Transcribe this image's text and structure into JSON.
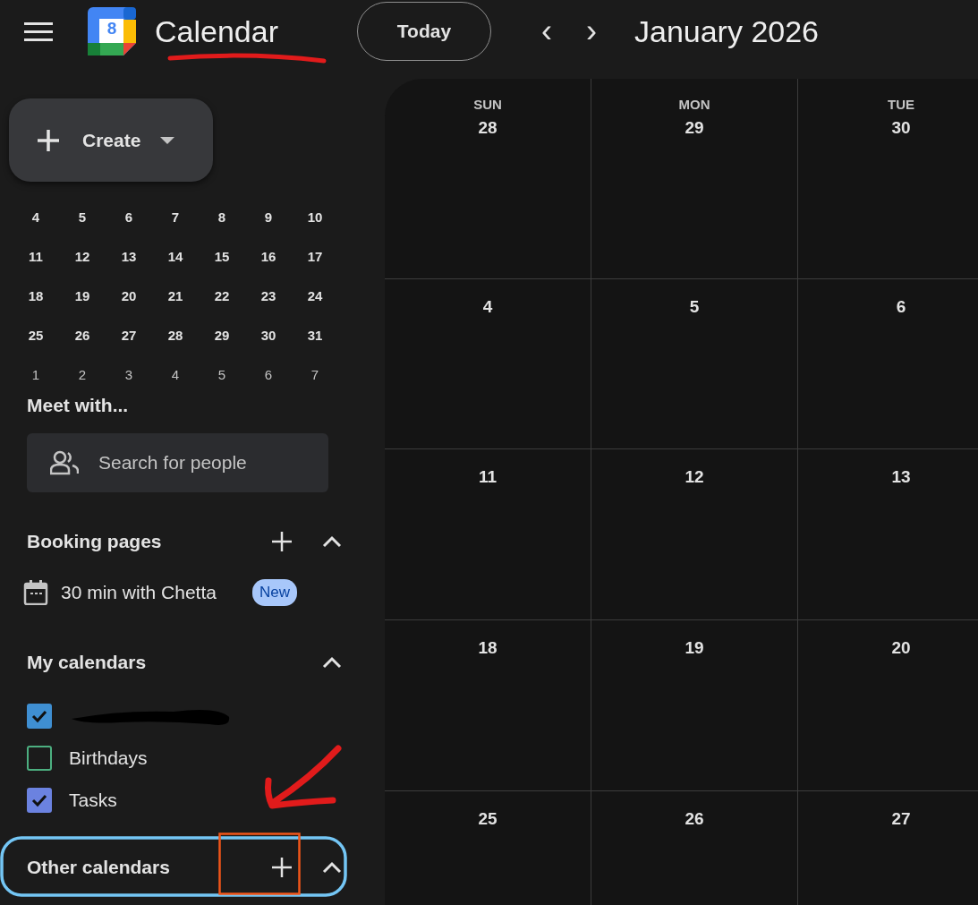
{
  "header": {
    "logo_digit": "8",
    "app_title": "Calendar",
    "today_button": "Today",
    "prev": "‹",
    "next": "›",
    "month_title": "January 2026"
  },
  "sidebar": {
    "create_button": "Create",
    "mini_calendar": {
      "weeks": [
        {
          "other_month": false,
          "days": [
            "4",
            "5",
            "6",
            "7",
            "8",
            "9",
            "10"
          ]
        },
        {
          "other_month": false,
          "days": [
            "11",
            "12",
            "13",
            "14",
            "15",
            "16",
            "17"
          ]
        },
        {
          "other_month": false,
          "days": [
            "18",
            "19",
            "20",
            "21",
            "22",
            "23",
            "24"
          ]
        },
        {
          "other_month": false,
          "days": [
            "25",
            "26",
            "27",
            "28",
            "29",
            "30",
            "31"
          ]
        },
        {
          "other_month": true,
          "days": [
            "1",
            "2",
            "3",
            "4",
            "5",
            "6",
            "7"
          ]
        }
      ]
    },
    "meet_with": {
      "title": "Meet with...",
      "search": {
        "placeholder": "Search for people"
      }
    },
    "booking_pages": {
      "title": "Booking pages",
      "expanded": true,
      "items": [
        {
          "label": "30 min with Chetta",
          "badge": "New"
        }
      ]
    },
    "my_calendars": {
      "title": "My calendars",
      "expanded": true,
      "items": [
        {
          "kind": "redacted",
          "checked": true,
          "color": "#3f8fd2"
        },
        {
          "kind": "label",
          "label": "Birthdays",
          "checked": false,
          "color": "#4caf80"
        },
        {
          "kind": "label",
          "label": "Tasks",
          "checked": true,
          "color": "#6b82e0"
        }
      ]
    },
    "other_calendars": {
      "title": "Other calendars",
      "expanded": true
    }
  },
  "month_grid": {
    "columns": [
      "SUN",
      "MON",
      "TUE"
    ],
    "weeks": [
      [
        "28",
        "29",
        "30"
      ],
      [
        "4",
        "5",
        "6"
      ],
      [
        "11",
        "12",
        "13"
      ],
      [
        "18",
        "19",
        "20"
      ],
      [
        "25",
        "26",
        "27"
      ]
    ]
  }
}
